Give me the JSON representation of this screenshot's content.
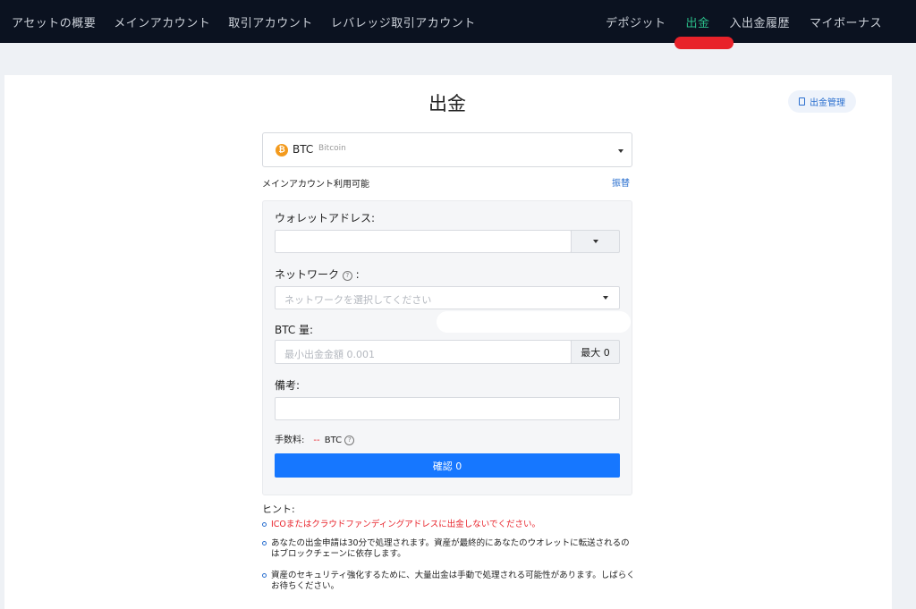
{
  "nav": {
    "left": [
      "アセットの概要",
      "メインアカウント",
      "取引アカウント",
      "レバレッジ取引アカウント"
    ],
    "right": [
      "デポジット",
      "出金",
      "入出金履歴",
      "マイボーナス"
    ],
    "active": "出金"
  },
  "page": {
    "title": "出金",
    "manage_label": "出金管理"
  },
  "coin": {
    "icon_symbol": "₿",
    "code": "BTC",
    "name": "Bitcoin"
  },
  "account": {
    "available_label": "メインアカウント利用可能",
    "transfer_label": "振替"
  },
  "form": {
    "wallet_label": "ウォレットアドレス:",
    "wallet_value": "",
    "network_label": "ネットワーク",
    "network_placeholder": "ネットワークを選択してください",
    "amount_label": "BTC 量:",
    "amount_placeholder": "最小出金金額 0.001",
    "max_label": "最大 0",
    "memo_label": "備考:",
    "memo_value": "",
    "fee_label": "手数料:",
    "fee_value": "--",
    "fee_unit": "BTC",
    "confirm_label": "確認 0",
    "help_symbol": "?",
    "colon": ":"
  },
  "hints": {
    "title": "ヒント:",
    "items": [
      "ICOまたはクラウドファンディングアドレスに出金しないでください。",
      "あなたの出金申請は30分で処理されます。資産が最終的にあなたのウオレットに転送されるのはブロックチェーンに依存します。",
      "資産のセキュリティ強化するために、大量出金は手動で処理される可能性があります。しばらくお待ちください。"
    ]
  },
  "colors": {
    "active_nav": "#2bbf8a",
    "primary": "#1677ff",
    "warning": "#e8222a",
    "coin": "#f39a1d"
  }
}
